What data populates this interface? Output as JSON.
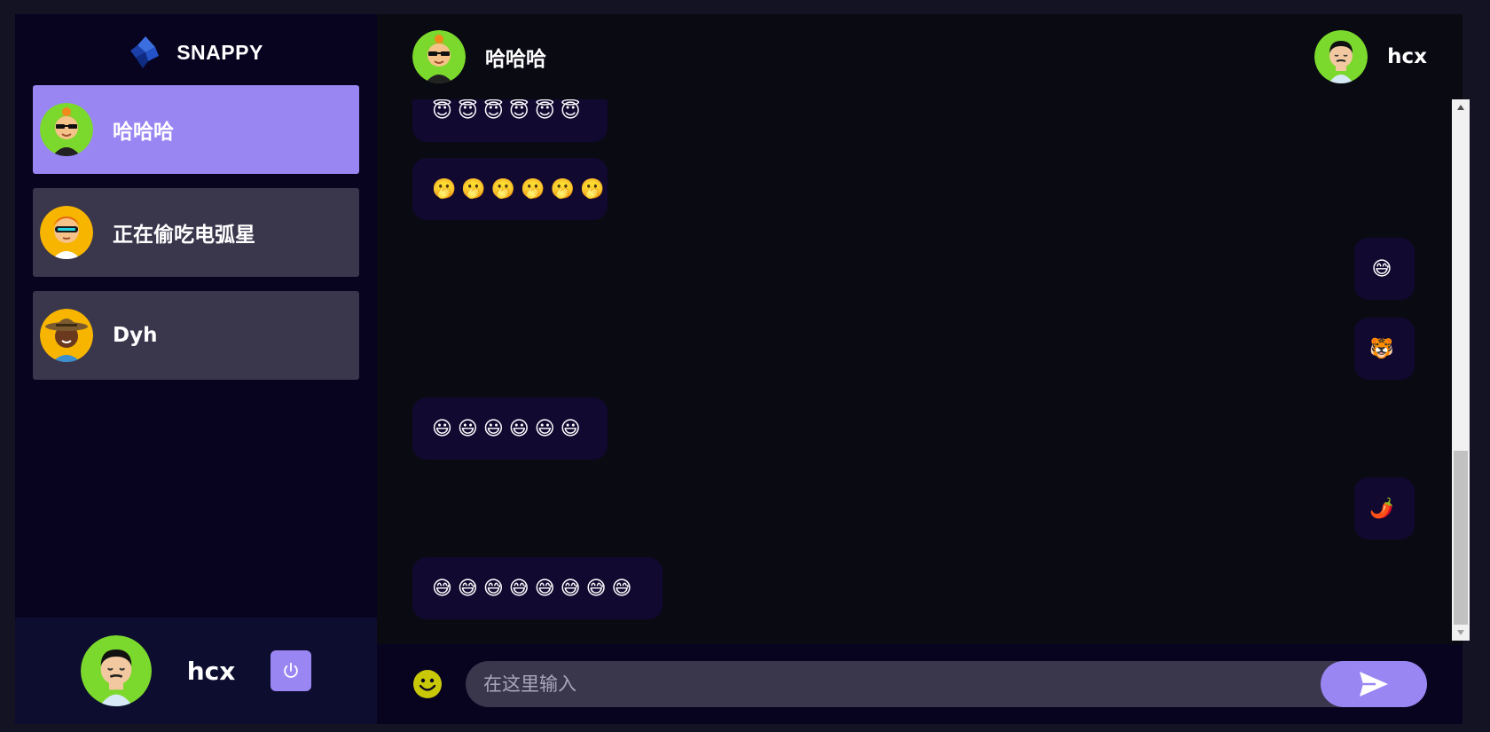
{
  "brand": {
    "name": "SNAPPY"
  },
  "contacts": [
    {
      "name": "哈哈哈",
      "selected": true
    },
    {
      "name": "正在偷吃电弧星",
      "selected": false
    },
    {
      "name": "Dyh",
      "selected": false
    }
  ],
  "current_user": {
    "name": "hcx"
  },
  "chat_header": {
    "contact_name": "哈哈哈",
    "user_name": "hcx"
  },
  "messages": [
    {
      "direction": "received",
      "text": "😇😇😇😇😇😇"
    },
    {
      "direction": "received",
      "text": "🫢🫢🫢🫢🫢🫢"
    },
    {
      "direction": "sent",
      "text": "😅"
    },
    {
      "direction": "sent",
      "text": "🐯"
    },
    {
      "direction": "received",
      "text": "😃😃😃😃😃😃"
    },
    {
      "direction": "sent",
      "text": "🌶️"
    },
    {
      "direction": "received",
      "text": "😅😅😅😅😅😅😅😅"
    }
  ],
  "composer": {
    "placeholder": "在这里输入"
  },
  "colors": {
    "accent": "#9a86f3",
    "sidebar": "#080420",
    "bubble": "#4f04ff21"
  }
}
